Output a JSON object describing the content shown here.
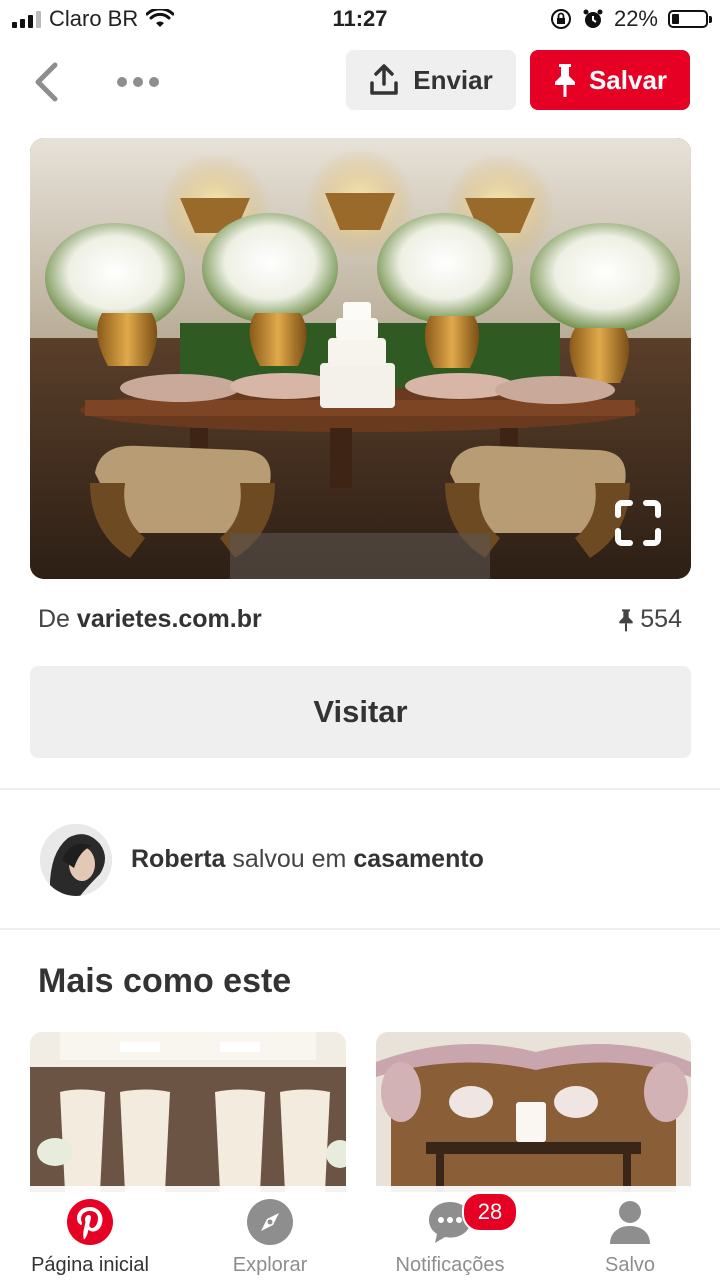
{
  "status_bar": {
    "carrier": "Claro BR",
    "time": "11:27",
    "battery": "22%"
  },
  "header": {
    "send_label": "Enviar",
    "save_label": "Salvar"
  },
  "pin": {
    "source_prefix": "De",
    "source_domain": "varietes.com.br",
    "save_count": "554",
    "visit_label": "Visitar"
  },
  "activity": {
    "user": "Roberta",
    "action": "salvou em",
    "board": "casamento"
  },
  "more_like_this": {
    "title": "Mais como este"
  },
  "bottom_nav": {
    "items": [
      {
        "label": "Página inicial"
      },
      {
        "label": "Explorar"
      },
      {
        "label": "Notificações",
        "badge": "28"
      },
      {
        "label": "Salvo"
      }
    ]
  },
  "colors": {
    "accent": "#e60023",
    "button_gray": "#efefef"
  }
}
